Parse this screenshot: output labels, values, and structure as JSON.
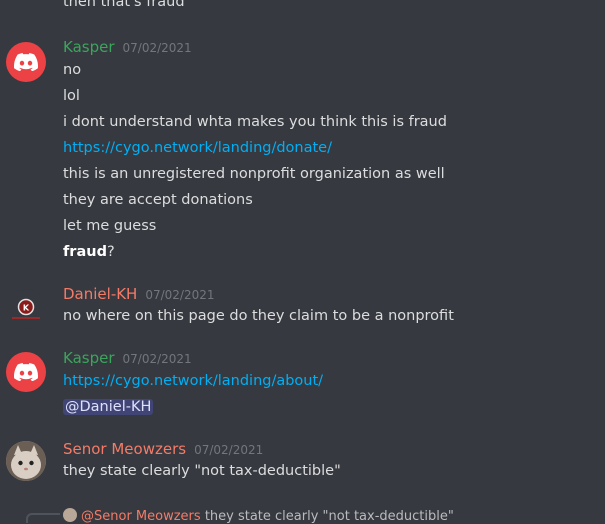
{
  "colors": {
    "background": "#36393f",
    "text": "#dcddde",
    "kasper": "#3ba55c",
    "daniel": "#f47b67",
    "senor": "#f47b67",
    "link": "#00aff4",
    "timestamp": "#72767d"
  },
  "top_partial": "then that's fraud",
  "groups": [
    {
      "username": "Kasper",
      "timestamp": "07/02/2021",
      "avatar": "discord-logo-icon",
      "messages": [
        "no",
        "lol",
        "i dont understand whta makes you think this is fraud",
        "https://cygo.network/landing/donate/",
        "this is an unregistered nonprofit organization as well",
        "they are accept donations",
        "let me guess"
      ],
      "bold_word": "fraud",
      "bold_suffix": "?"
    },
    {
      "username": "Daniel-KH",
      "timestamp": "07/02/2021",
      "avatar": "kh-logo-icon",
      "messages": [
        "no where on this page do they claim to be a nonprofit"
      ]
    },
    {
      "username": "Kasper",
      "timestamp": "07/02/2021",
      "avatar": "discord-logo-icon",
      "messages": [
        "https://cygo.network/landing/about/"
      ],
      "mention": "@Daniel-KH"
    },
    {
      "username": "Senor Meowzers",
      "timestamp": "07/02/2021",
      "avatar": "cat-avatar-icon",
      "messages": [
        "they state clearly \"not tax-deductible\""
      ]
    }
  ],
  "reply": {
    "mention": "@Senor Meowzers",
    "text": "they state clearly \"not tax-deductible\""
  }
}
